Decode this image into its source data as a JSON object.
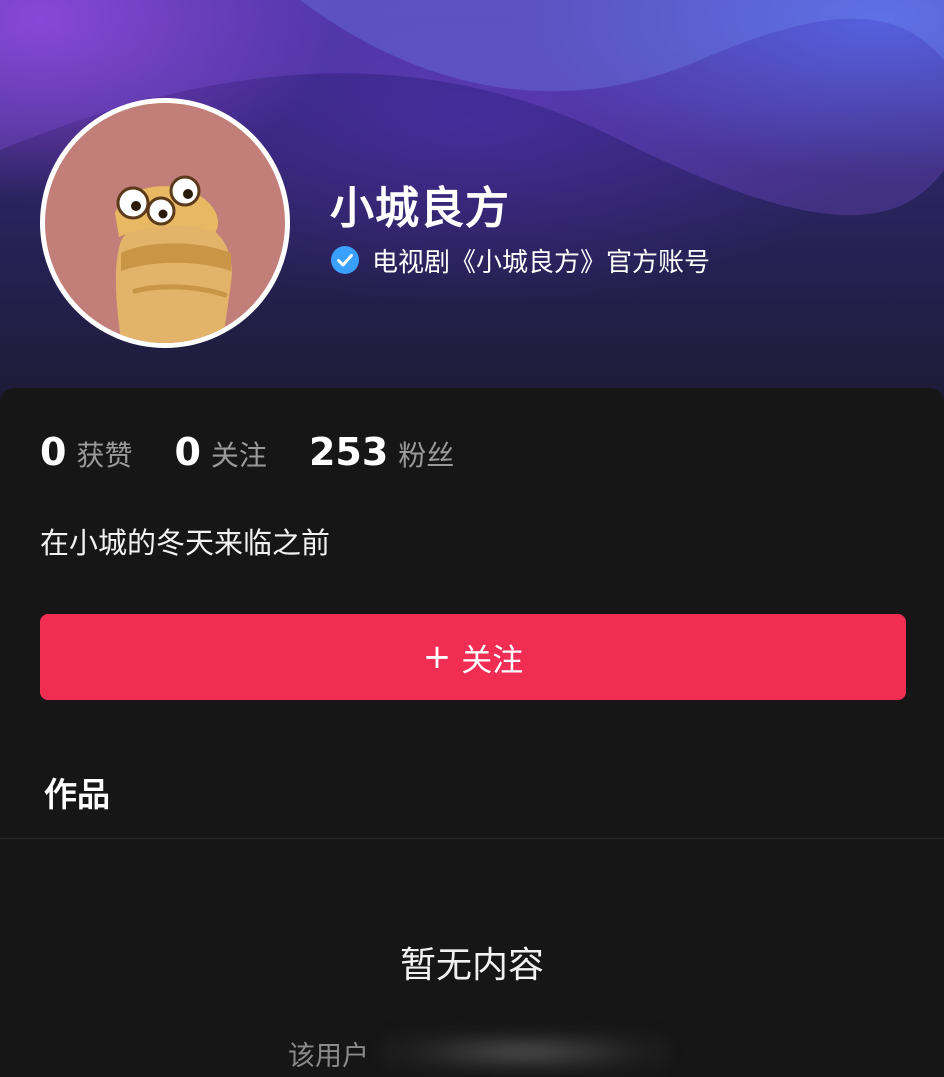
{
  "profile": {
    "name": "小城良方",
    "verified_text": "电视剧《小城良方》官方账号"
  },
  "stats": [
    {
      "value": "0",
      "label": "获赞"
    },
    {
      "value": "0",
      "label": "关注"
    },
    {
      "value": "253",
      "label": "粉丝"
    }
  ],
  "bio": "在小城的冬天来临之前",
  "follow_button": {
    "icon": "+",
    "label": "关注"
  },
  "tabs": {
    "works_label": "作品"
  },
  "empty_state": {
    "title": "暂无内容",
    "subtitle_visible": "该用户"
  },
  "colors": {
    "follow_button": "#f22d54",
    "background": "#161616",
    "verified_badge": "#3aa0ff",
    "avatar_background": "#c27e78"
  }
}
